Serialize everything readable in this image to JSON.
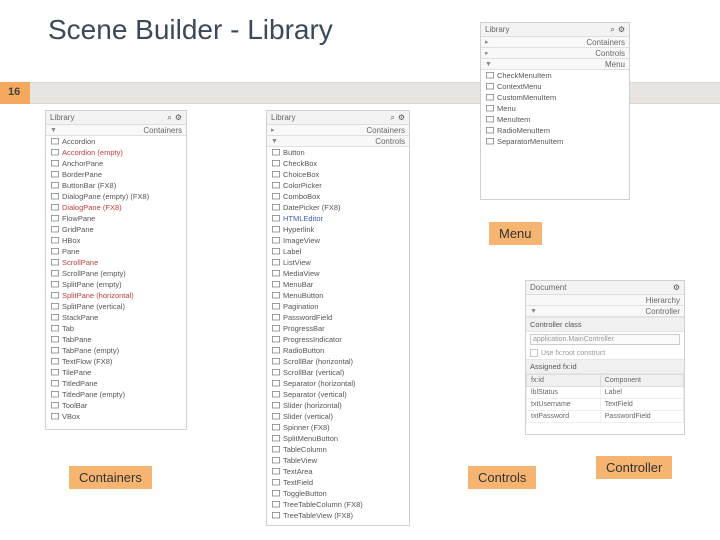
{
  "title": "Scene Builder - Library",
  "page_number": "16",
  "captions": {
    "containers": "Containers",
    "controls": "Controls",
    "menu": "Menu",
    "controller": "Controller"
  },
  "library_label": "Library",
  "search_icon": "⌕",
  "gear_icon": "⚙",
  "containers_panel": {
    "sections": [
      "Containers"
    ],
    "items": [
      {
        "label": "Accordion"
      },
      {
        "label": "Accordion (empty)",
        "style": "red"
      },
      {
        "label": "AnchorPane"
      },
      {
        "label": "BorderPane"
      },
      {
        "label": "ButtonBar (FX8)"
      },
      {
        "label": "DialogPane (empty) (FX8)"
      },
      {
        "label": "DialogPane (FX8)",
        "style": "red"
      },
      {
        "label": "FlowPane"
      },
      {
        "label": "GridPane"
      },
      {
        "label": "HBox"
      },
      {
        "label": "Pane"
      },
      {
        "label": "ScrollPane",
        "style": "red"
      },
      {
        "label": "ScrollPane (empty)"
      },
      {
        "label": "SplitPane (empty)"
      },
      {
        "label": "SplitPane (horizontal)",
        "style": "red"
      },
      {
        "label": "SplitPane (vertical)"
      },
      {
        "label": "StackPane"
      },
      {
        "label": "Tab"
      },
      {
        "label": "TabPane"
      },
      {
        "label": "TabPane (empty)"
      },
      {
        "label": "TextFlow (FX8)"
      },
      {
        "label": "TilePane"
      },
      {
        "label": "TitledPane"
      },
      {
        "label": "TitledPane (empty)"
      },
      {
        "label": "ToolBar"
      },
      {
        "label": "VBox"
      }
    ]
  },
  "controls_panel": {
    "sections": [
      "Containers",
      "Controls"
    ],
    "items": [
      {
        "label": "Button"
      },
      {
        "label": "CheckBox"
      },
      {
        "label": "ChoiceBox"
      },
      {
        "label": "ColorPicker"
      },
      {
        "label": "ComboBox"
      },
      {
        "label": "DatePicker (FX8)"
      },
      {
        "label": "HTMLEditor",
        "style": "blue"
      },
      {
        "label": "Hyperlink"
      },
      {
        "label": "ImageView"
      },
      {
        "label": "Label"
      },
      {
        "label": "ListView"
      },
      {
        "label": "MediaView"
      },
      {
        "label": "MenuBar"
      },
      {
        "label": "MenuButton"
      },
      {
        "label": "Pagination"
      },
      {
        "label": "PasswordField"
      },
      {
        "label": "ProgressBar"
      },
      {
        "label": "ProgressIndicator"
      },
      {
        "label": "RadioButton"
      },
      {
        "label": "ScrollBar (horizontal)"
      },
      {
        "label": "ScrollBar (vertical)"
      },
      {
        "label": "Separator (horizontal)"
      },
      {
        "label": "Separator (vertical)"
      },
      {
        "label": "Slider (horizontal)"
      },
      {
        "label": "Slider (vertical)"
      },
      {
        "label": "Spinner (FX8)"
      },
      {
        "label": "SplitMenuButton"
      },
      {
        "label": "TableColumn"
      },
      {
        "label": "TableView"
      },
      {
        "label": "TextArea"
      },
      {
        "label": "TextField"
      },
      {
        "label": "ToggleButton"
      },
      {
        "label": "TreeTableColumn (FX8)"
      },
      {
        "label": "TreeTableView (FX8)"
      }
    ]
  },
  "menu_panel": {
    "sections": [
      "Containers",
      "Controls",
      "Menu"
    ],
    "items": [
      {
        "label": "CheckMenuItem"
      },
      {
        "label": "ContextMenu"
      },
      {
        "label": "CustomMenuItem"
      },
      {
        "label": "Menu"
      },
      {
        "label": "MenuItem"
      },
      {
        "label": "RadioMenuItem"
      },
      {
        "label": "SeparatorMenuItem"
      }
    ]
  },
  "document_panel": {
    "title": "Document",
    "tabs": [
      "Hierarchy",
      "Controller"
    ],
    "controller_class_label": "Controller class",
    "controller_class_value": "application.MainController",
    "checkbox_label": "Use fx:root construct",
    "assigned_label": "Assigned fx:id",
    "table_headers": [
      "fx:id",
      "Component"
    ],
    "table_rows": [
      [
        "lblStatus",
        "Label"
      ],
      [
        "txtUsername",
        "TextField"
      ],
      [
        "txtPassword",
        "PasswordField"
      ]
    ]
  }
}
